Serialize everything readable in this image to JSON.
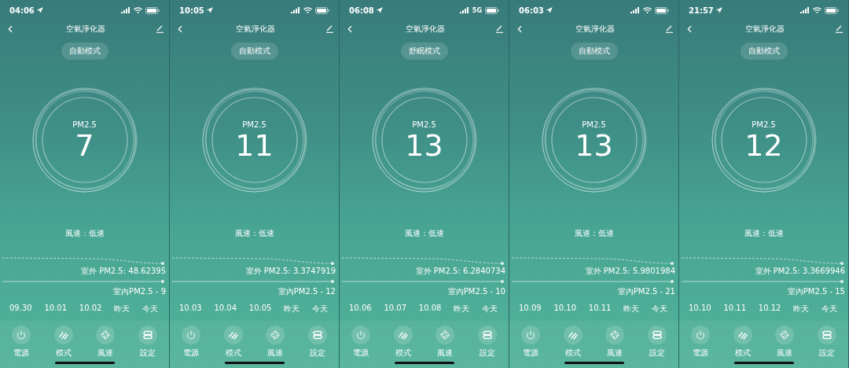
{
  "panels": [
    {
      "status": {
        "time": "04:06",
        "network": {
          "kind": "wifi"
        }
      },
      "title": "空氣淨化器",
      "mode": "自動模式",
      "pm_label": "PM2.5",
      "pm_value": "7",
      "wind": "風速：低速",
      "outdoor": "室外 PM2.5: 48.62395",
      "indoor": "室內PM2.5 - 9",
      "dates": [
        "09.30",
        "10.01",
        "10.02",
        "昨天",
        "今天"
      ],
      "controls": [
        {
          "kind": "power",
          "label": "電源"
        },
        {
          "kind": "mode",
          "label": "模式"
        },
        {
          "kind": "fan",
          "label": "風速"
        },
        {
          "kind": "settings",
          "label": "設定"
        }
      ]
    },
    {
      "status": {
        "time": "10:05",
        "network": {
          "kind": "wifi"
        }
      },
      "title": "空氣淨化器",
      "mode": "自動模式",
      "pm_label": "PM2.5",
      "pm_value": "11",
      "wind": "風速：低速",
      "outdoor": "室外 PM2.5: 3.3747919",
      "indoor": "室內PM2.5 - 12",
      "dates": [
        "10.03",
        "10.04",
        "10.05",
        "昨天",
        "今天"
      ],
      "controls": [
        {
          "kind": "power",
          "label": "電源"
        },
        {
          "kind": "mode",
          "label": "模式"
        },
        {
          "kind": "fan",
          "label": "風速"
        },
        {
          "kind": "settings",
          "label": "設定"
        }
      ]
    },
    {
      "status": {
        "time": "06:08",
        "network": {
          "kind": "text",
          "label": "5G"
        }
      },
      "title": "空氣淨化器",
      "mode": "舒眠模式",
      "pm_label": "PM2.5",
      "pm_value": "13",
      "wind": "風速：低速",
      "outdoor": "室外 PM2.5: 6.2840734",
      "indoor": "室內PM2.5 - 10",
      "dates": [
        "10.06",
        "10.07",
        "10.08",
        "昨天",
        "今天"
      ],
      "controls": [
        {
          "kind": "power",
          "label": "電源"
        },
        {
          "kind": "mode",
          "label": "模式"
        },
        {
          "kind": "fan",
          "label": "風速"
        },
        {
          "kind": "settings",
          "label": "設定"
        }
      ]
    },
    {
      "status": {
        "time": "06:03",
        "network": {
          "kind": "wifi"
        }
      },
      "title": "空氣淨化器",
      "mode": "自動模式",
      "pm_label": "PM2.5",
      "pm_value": "13",
      "wind": "風速：低速",
      "outdoor": "室外 PM2.5: 5.9801984",
      "indoor": "室內PM2.5 - 21",
      "dates": [
        "10.09",
        "10.10",
        "10.11",
        "昨天",
        "今天"
      ],
      "controls": [
        {
          "kind": "power",
          "label": "電源"
        },
        {
          "kind": "mode",
          "label": "模式"
        },
        {
          "kind": "fan",
          "label": "風速"
        },
        {
          "kind": "settings",
          "label": "設定"
        }
      ]
    },
    {
      "status": {
        "time": "21:57",
        "network": {
          "kind": "wifi"
        }
      },
      "title": "空氣淨化器",
      "mode": "自動模式",
      "pm_label": "PM2.5",
      "pm_value": "12",
      "wind": "風速：低速",
      "outdoor": "室外 PM2.5: 3.3669946",
      "indoor": "室內PM2.5 - 15",
      "dates": [
        "10.10",
        "10.11",
        "10.12",
        "昨天",
        "今天"
      ],
      "controls": [
        {
          "kind": "power",
          "label": "電源"
        },
        {
          "kind": "mode",
          "label": "模式"
        },
        {
          "kind": "fan",
          "label": "風速"
        },
        {
          "kind": "settings",
          "label": "設定"
        }
      ]
    }
  ]
}
